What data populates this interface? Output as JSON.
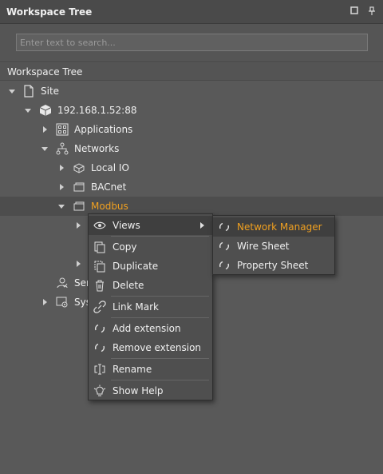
{
  "panel": {
    "title": "Workspace Tree"
  },
  "search": {
    "placeholder": "Enter text to search..."
  },
  "tree_header": "Workspace Tree",
  "tree": {
    "site": "Site",
    "ip": "192.168.1.52:88",
    "applications": "Applications",
    "networks": "Networks",
    "local_io": "Local IO",
    "bacnet": "BACnet",
    "modbus": "Modbus",
    "services_partial": "Ser",
    "system_partial": "Sys"
  },
  "context_menu": {
    "views": "Views",
    "copy": "Copy",
    "duplicate": "Duplicate",
    "delete": "Delete",
    "link_mark": "Link Mark",
    "add_extension": "Add extension",
    "remove_extension": "Remove extension",
    "rename": "Rename",
    "show_help": "Show Help"
  },
  "submenu": {
    "network_manager": "Network Manager",
    "wire_sheet": "Wire Sheet",
    "property_sheet": "Property Sheet"
  },
  "colors": {
    "accent": "#f0a020",
    "background": "#595959"
  }
}
